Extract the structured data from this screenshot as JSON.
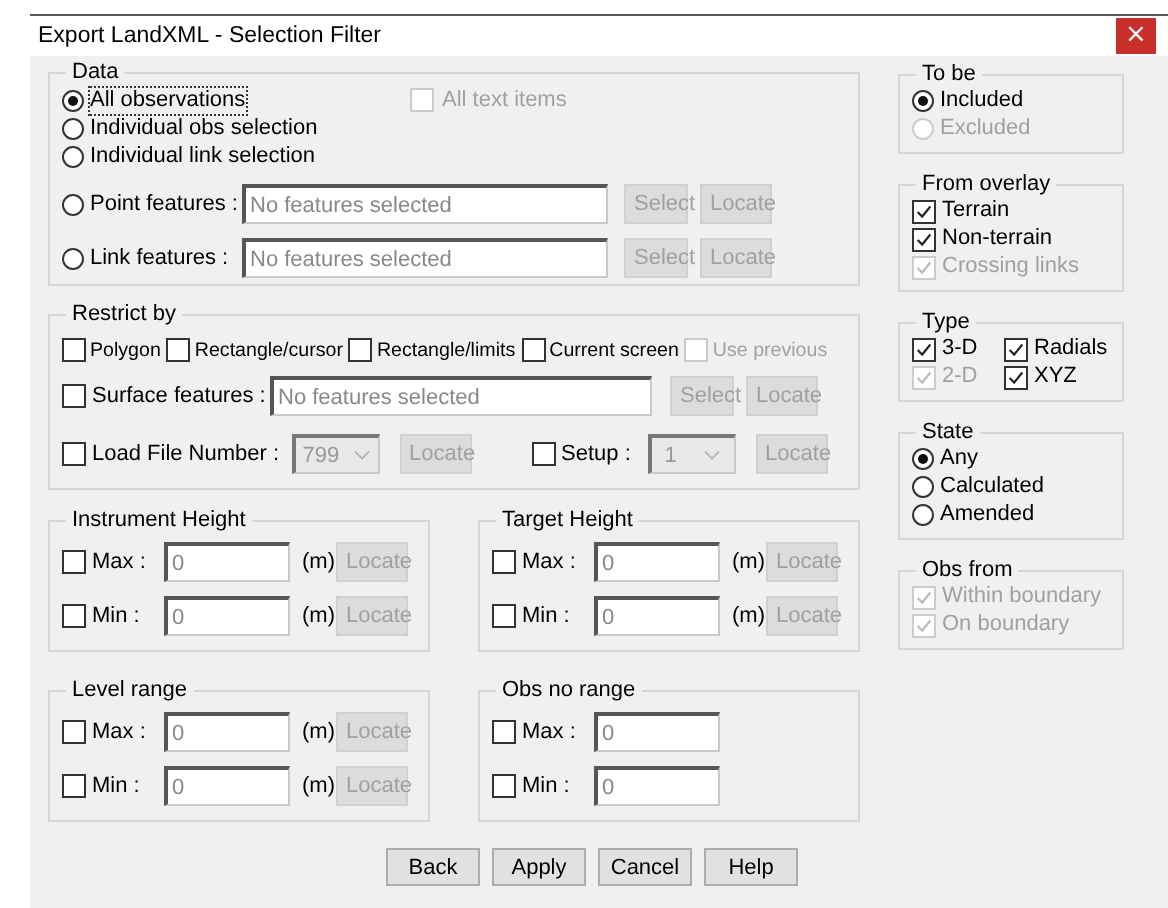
{
  "window": {
    "title": "Export LandXML - Selection Filter",
    "close": "×"
  },
  "data": {
    "title": "Data",
    "options": [
      {
        "kind": "plain",
        "label": "All observations",
        "selected": true,
        "focused": true
      },
      {
        "kind": "plain",
        "label": "Individual obs selection",
        "selected": false,
        "focused": false
      },
      {
        "kind": "plain",
        "label": "Individual link selection",
        "selected": false,
        "focused": false
      },
      {
        "kind": "feature",
        "label": "Point features :",
        "selected": false,
        "focused": false,
        "placeholder": "No features selected",
        "buttons": [
          {
            "label": "Select",
            "disabled": true
          },
          {
            "label": "Locate",
            "disabled": true
          }
        ]
      },
      {
        "kind": "feature",
        "label": "Link features :",
        "selected": false,
        "focused": false,
        "placeholder": "No features selected",
        "buttons": [
          {
            "label": "Select",
            "disabled": true
          },
          {
            "label": "Locate",
            "disabled": true
          }
        ]
      }
    ],
    "all_text_items": {
      "label": "All text items",
      "checked": false,
      "disabled": true
    }
  },
  "restrict": {
    "title": "Restrict by",
    "options": [
      {
        "label": "Polygon",
        "checked": false,
        "disabled": false
      },
      {
        "label": "Rectangle/cursor",
        "checked": false,
        "disabled": false
      },
      {
        "label": "Rectangle/limits",
        "checked": false,
        "disabled": false
      },
      {
        "label": "Current screen",
        "checked": false,
        "disabled": false
      },
      {
        "label": "Use previous",
        "checked": false,
        "disabled": true
      }
    ],
    "surface": {
      "label": "Surface features :",
      "checked": false,
      "placeholder": "No features selected",
      "buttons": [
        {
          "label": "Select",
          "disabled": true
        },
        {
          "label": "Locate",
          "disabled": true
        }
      ]
    },
    "load_file": {
      "label": "Load File Number :",
      "checked": false,
      "combo": {
        "value": "799",
        "disabled": true
      },
      "button": {
        "label": "Locate",
        "disabled": true
      }
    },
    "setup": {
      "label": "Setup :",
      "checked": false,
      "combo": {
        "value": "1",
        "disabled": true
      },
      "button": {
        "label": "Locate",
        "disabled": true
      }
    }
  },
  "ranges": [
    {
      "title": "Instrument Height",
      "rows": [
        {
          "label": "Max :",
          "checked": false,
          "hovered": false,
          "value": "0",
          "unit": "(m)",
          "button": {
            "label": "Locate",
            "disabled": true
          }
        },
        {
          "label": "Min :",
          "checked": false,
          "hovered": false,
          "value": "0",
          "unit": "(m)",
          "button": {
            "label": "Locate",
            "disabled": true
          }
        }
      ]
    },
    {
      "title": "Target Height",
      "rows": [
        {
          "label": "Max :",
          "checked": false,
          "hovered": false,
          "value": "0",
          "unit": "(m)",
          "button": {
            "label": "Locate",
            "disabled": true
          }
        },
        {
          "label": "Min :",
          "checked": false,
          "hovered": false,
          "value": "0",
          "unit": "(m)",
          "button": {
            "label": "Locate",
            "disabled": true
          }
        }
      ]
    },
    {
      "title": "Level range",
      "rows": [
        {
          "label": "Max :",
          "checked": false,
          "hovered": false,
          "value": "0",
          "unit": "(m)",
          "button": {
            "label": "Locate",
            "disabled": true
          }
        },
        {
          "label": "Min :",
          "checked": false,
          "hovered": false,
          "value": "0",
          "unit": "(m)",
          "button": {
            "label": "Locate",
            "disabled": true
          }
        }
      ]
    },
    {
      "title": "Obs no range",
      "rows": [
        {
          "label": "Max :",
          "checked": false,
          "hovered": false,
          "value": "0"
        },
        {
          "label": "Min :",
          "checked": false,
          "hovered": false,
          "value": "0"
        }
      ]
    }
  ],
  "side_groups": [
    {
      "title": "To be",
      "kind": "radio",
      "items": [
        {
          "label": "Included",
          "selected": true,
          "disabled": false
        },
        {
          "label": "Excluded",
          "selected": false,
          "disabled": true
        }
      ]
    },
    {
      "title": "From overlay",
      "kind": "checkbox",
      "items": [
        {
          "label": "Terrain",
          "checked": true,
          "disabled": false
        },
        {
          "label": "Non-terrain",
          "checked": true,
          "disabled": false
        },
        {
          "label": "Crossing links",
          "checked": true,
          "disabled": true
        }
      ]
    },
    {
      "title": "Type",
      "kind": "checkbox-grid",
      "items": [
        {
          "label": "3-D",
          "checked": true,
          "disabled": false
        },
        {
          "label": "Radials",
          "checked": true,
          "disabled": false
        },
        {
          "label": "2-D",
          "checked": true,
          "disabled": true
        },
        {
          "label": "XYZ",
          "checked": true,
          "disabled": false
        }
      ]
    },
    {
      "title": "State",
      "kind": "radio",
      "items": [
        {
          "label": "Any",
          "selected": true,
          "disabled": false
        },
        {
          "label": "Calculated",
          "selected": false,
          "disabled": false
        },
        {
          "label": "Amended",
          "selected": false,
          "disabled": false
        }
      ]
    },
    {
      "title": "Obs from",
      "kind": "checkbox",
      "items": [
        {
          "label": "Within boundary",
          "checked": true,
          "disabled": true
        },
        {
          "label": "On boundary",
          "checked": true,
          "disabled": true
        }
      ]
    }
  ],
  "buttons": [
    {
      "label": "Back"
    },
    {
      "label": "Apply"
    },
    {
      "label": "Cancel"
    },
    {
      "label": "Help"
    }
  ]
}
